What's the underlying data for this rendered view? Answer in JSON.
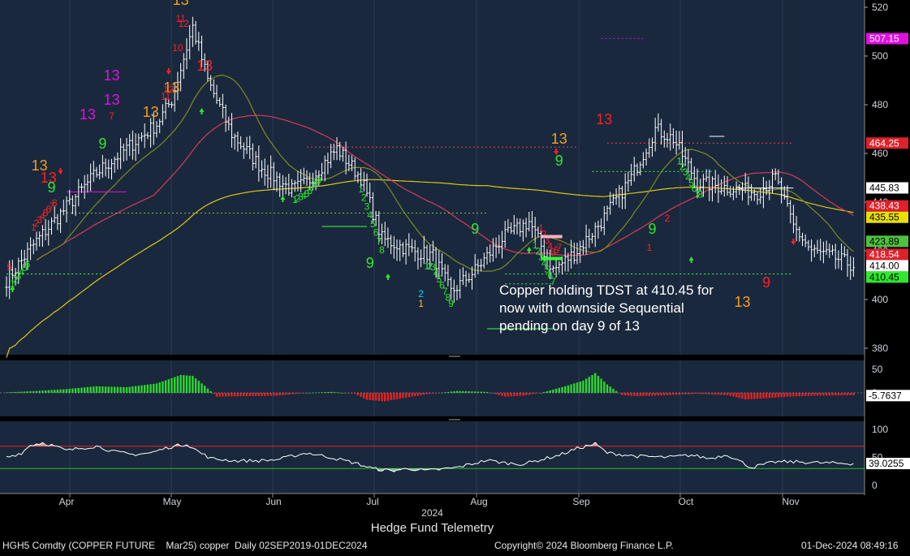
{
  "chart_data": [
    {
      "type": "candlestick",
      "panel": "price",
      "ylim": [
        372,
        522
      ],
      "yticks": [
        "380",
        "400",
        "420",
        "440",
        "460",
        "480",
        "500",
        "520"
      ],
      "x_months": [
        "Apr",
        "May",
        "Jun",
        "Jul",
        "Aug",
        "Sep",
        "Oct",
        "Nov"
      ],
      "x_year": "2024",
      "anchors": [
        [
          0,
          408
        ],
        [
          10,
          424
        ],
        [
          20,
          438
        ],
        [
          30,
          452
        ],
        [
          40,
          462
        ],
        [
          50,
          472
        ],
        [
          55,
          482
        ],
        [
          62,
          512
        ],
        [
          67,
          490
        ],
        [
          75,
          468
        ],
        [
          85,
          454
        ],
        [
          95,
          445
        ],
        [
          100,
          448
        ],
        [
          110,
          462
        ],
        [
          118,
          450
        ],
        [
          125,
          425
        ],
        [
          135,
          420
        ],
        [
          142,
          418
        ],
        [
          148,
          403
        ],
        [
          156,
          412
        ],
        [
          165,
          425
        ],
        [
          174,
          432
        ],
        [
          182,
          412
        ],
        [
          190,
          420
        ],
        [
          198,
          432
        ],
        [
          208,
          450
        ],
        [
          216,
          470
        ],
        [
          222,
          466
        ],
        [
          230,
          448
        ],
        [
          240,
          446
        ],
        [
          250,
          444
        ],
        [
          256,
          450
        ],
        [
          262,
          430
        ],
        [
          268,
          420
        ],
        [
          276,
          417
        ],
        [
          282,
          414
        ]
      ],
      "last_price": "414.00",
      "right_labels": [
        {
          "text": "507.15",
          "value": 507.15,
          "bg": "#e010e0",
          "fg": "#ffffff"
        },
        {
          "text": "464.25",
          "value": 464.25,
          "bg": "#e0202a",
          "fg": "#ffffff"
        },
        {
          "text": "445.83",
          "value": 445.83,
          "bg": "#ffffff",
          "fg": "#000000"
        },
        {
          "text": "438.43",
          "value": 438.43,
          "bg": "#e0202a",
          "fg": "#ffffff"
        },
        {
          "text": "435.55",
          "value": 435.55,
          "bg": "#e8e000",
          "fg": "#000000"
        },
        {
          "text": "423.89",
          "value": 423.89,
          "bg": "#50c040",
          "fg": "#000000"
        },
        {
          "text": "418.54",
          "value": 418.54,
          "bg": "#e0202a",
          "fg": "#ffffff"
        },
        {
          "text": "414.00",
          "value": 414.0,
          "bg": "#ffffff",
          "fg": "#000000"
        },
        {
          "text": "410.45",
          "value": 410.45,
          "bg": "#2ee82e",
          "fg": "#000000"
        }
      ],
      "annotation": [
        "Copper holding TDST at 410.45 for",
        "now with downside Sequential",
        "pending on day 9 of 13"
      ],
      "td_labels": [
        {
          "t": "13",
          "i": 58,
          "v": 521,
          "c": "#f0a020"
        },
        {
          "t": "12",
          "i": 59,
          "v": 512,
          "c": "#ff2020"
        },
        {
          "t": "11",
          "i": 58,
          "v": 514,
          "c": "#ff2020"
        },
        {
          "t": "10",
          "i": 57,
          "v": 502,
          "c": "#ff2020"
        },
        {
          "t": "13",
          "i": 66,
          "v": 494,
          "c": "#ff2020"
        },
        {
          "t": "13",
          "i": 55,
          "v": 485,
          "c": "#f0a020"
        },
        {
          "t": "12",
          "i": 54,
          "v": 485,
          "c": "#ff2020"
        },
        {
          "t": "11",
          "i": 53,
          "v": 482,
          "c": "#ff2020"
        },
        {
          "t": "13",
          "i": 35,
          "v": 490,
          "c": "#e010e0"
        },
        {
          "t": "13",
          "i": 35,
          "v": 480,
          "c": "#e010e0"
        },
        {
          "t": "13",
          "i": 27,
          "v": 474,
          "c": "#e010e0"
        },
        {
          "t": "13",
          "i": 48,
          "v": 475,
          "c": "#f0a020"
        },
        {
          "t": "7",
          "i": 35,
          "v": 474,
          "c": "#ff2020"
        },
        {
          "t": "13",
          "i": 11,
          "v": 453,
          "c": "#f0a020"
        },
        {
          "t": "13",
          "i": 14,
          "v": 448,
          "c": "#ff2020"
        },
        {
          "t": "9",
          "i": 15,
          "v": 444,
          "c": "#2ee82e"
        },
        {
          "t": "9",
          "i": 32,
          "v": 462,
          "c": "#2ee82e"
        },
        {
          "t": "5",
          "i": 1,
          "v": 412,
          "c": "#ff2020"
        },
        {
          "t": "9",
          "i": 121,
          "v": 413,
          "c": "#2ee82e"
        },
        {
          "t": "9",
          "i": 156,
          "v": 427,
          "c": "#2ee82e"
        },
        {
          "t": "13",
          "i": 184,
          "v": 464,
          "c": "#f0a020"
        },
        {
          "t": "9",
          "i": 184,
          "v": 455,
          "c": "#2ee82e"
        },
        {
          "t": "13",
          "i": 199,
          "v": 472,
          "c": "#ff2020"
        },
        {
          "t": "9",
          "i": 215,
          "v": 427,
          "c": "#2ee82e"
        },
        {
          "t": "13",
          "i": 245,
          "v": 397,
          "c": "#f0a020"
        },
        {
          "t": "9",
          "i": 253,
          "v": 405,
          "c": "#ff2020"
        },
        {
          "t": "1",
          "i": 138,
          "v": 397,
          "c": "#f0c030"
        },
        {
          "t": "2",
          "i": 138,
          "v": 401,
          "c": "#00d8ff"
        },
        {
          "t": "1",
          "i": 214,
          "v": 420,
          "c": "#ff2020"
        },
        {
          "t": "2",
          "i": 220,
          "v": 432,
          "c": "#ff2020"
        }
      ],
      "h_lines": [
        {
          "a": 100,
          "b": 190,
          "v": 462.6,
          "c": "#e8404a",
          "dash": "2,3"
        },
        {
          "a": 200,
          "b": 262,
          "v": 464.2,
          "c": "#e8404a",
          "dash": "2,3"
        },
        {
          "a": 20,
          "b": 160,
          "v": 435.5,
          "c": "#7ac050",
          "dash": "2,3"
        },
        {
          "a": 0,
          "b": 32,
          "v": 410.5,
          "c": "#40ff40",
          "dash": "2,3"
        },
        {
          "a": 166,
          "b": 182,
          "v": 406.4,
          "c": "#40ff40",
          "dash": "2,3"
        },
        {
          "a": 166,
          "b": 262,
          "v": 410.5,
          "c": "#40ff40",
          "dash": "2,3"
        },
        {
          "a": 195,
          "b": 235,
          "v": 452.6,
          "c": "#40ff40",
          "dash": "2,3"
        },
        {
          "a": 20,
          "b": 40,
          "v": 444.2,
          "c": "#e010e0",
          "dash": ""
        },
        {
          "a": 198,
          "b": 212,
          "v": 507.2,
          "c": "#e010e0",
          "dash": "2,3"
        },
        {
          "a": 243,
          "b": 262,
          "v": 445.8,
          "c": "#ffffff",
          "dash": ""
        },
        {
          "a": 234,
          "b": 239,
          "v": 467,
          "c": "#ffffff",
          "dash": ""
        },
        {
          "a": 105,
          "b": 120,
          "v": 430,
          "c": "#40ff40",
          "dash": ""
        },
        {
          "a": 160,
          "b": 182,
          "v": 388,
          "c": "#40ff40",
          "dash": ""
        }
      ]
    },
    {
      "type": "histogram",
      "panel": "macd",
      "ylim": [
        -16,
        58
      ],
      "yticks": [
        "50",
        "0"
      ],
      "last_value": "-5.7637",
      "anchors": [
        [
          0,
          1
        ],
        [
          10,
          4
        ],
        [
          20,
          8
        ],
        [
          30,
          14
        ],
        [
          40,
          12
        ],
        [
          50,
          20
        ],
        [
          58,
          38
        ],
        [
          62,
          36
        ],
        [
          66,
          15
        ],
        [
          70,
          -8
        ],
        [
          80,
          -7
        ],
        [
          90,
          -6
        ],
        [
          100,
          0
        ],
        [
          108,
          2
        ],
        [
          116,
          -2
        ],
        [
          120,
          -15
        ],
        [
          126,
          -18
        ],
        [
          133,
          -10
        ],
        [
          140,
          -3
        ],
        [
          150,
          4
        ],
        [
          160,
          2
        ],
        [
          166,
          -8
        ],
        [
          172,
          -6
        ],
        [
          178,
          0
        ],
        [
          186,
          14
        ],
        [
          192,
          26
        ],
        [
          196,
          42
        ],
        [
          200,
          18
        ],
        [
          205,
          -5
        ],
        [
          210,
          -7
        ],
        [
          220,
          -5
        ],
        [
          230,
          -2
        ],
        [
          240,
          -5
        ],
        [
          246,
          -14
        ],
        [
          252,
          -12
        ],
        [
          260,
          -8
        ],
        [
          268,
          -6
        ],
        [
          282,
          -5
        ]
      ]
    },
    {
      "type": "line",
      "panel": "rsi",
      "ylim": [
        -8,
        112
      ],
      "yticks": [
        "100",
        "50",
        "0"
      ],
      "last_value": "39.0255",
      "overbought": 70,
      "oversold": 30,
      "anchors": [
        [
          0,
          50
        ],
        [
          5,
          58
        ],
        [
          8,
          72
        ],
        [
          12,
          76
        ],
        [
          16,
          70
        ],
        [
          20,
          62
        ],
        [
          24,
          66
        ],
        [
          30,
          70
        ],
        [
          36,
          60
        ],
        [
          42,
          55
        ],
        [
          48,
          58
        ],
        [
          54,
          68
        ],
        [
          60,
          74
        ],
        [
          64,
          60
        ],
        [
          68,
          48
        ],
        [
          76,
          44
        ],
        [
          84,
          44
        ],
        [
          90,
          46
        ],
        [
          100,
          58
        ],
        [
          108,
          50
        ],
        [
          116,
          40
        ],
        [
          122,
          30
        ],
        [
          128,
          26
        ],
        [
          134,
          30
        ],
        [
          140,
          26
        ],
        [
          150,
          32
        ],
        [
          160,
          45
        ],
        [
          166,
          40
        ],
        [
          172,
          38
        ],
        [
          178,
          46
        ],
        [
          184,
          54
        ],
        [
          190,
          66
        ],
        [
          196,
          74
        ],
        [
          200,
          58
        ],
        [
          210,
          52
        ],
        [
          220,
          50
        ],
        [
          228,
          54
        ],
        [
          234,
          48
        ],
        [
          240,
          55
        ],
        [
          248,
          32
        ],
        [
          256,
          42
        ],
        [
          264,
          42
        ],
        [
          272,
          40
        ],
        [
          282,
          39
        ]
      ]
    }
  ],
  "footer": {
    "ticker": "HGH5 Comdty (COPPER FUTURE    Mar25) copper  Daily 02SEP2019-01DEC2024",
    "copyright": "Copyright© 2024 Bloomberg Finance L.P.",
    "timestamp": "01-Dec-2024 08:49:16",
    "watermark": "Hedge Fund Telemetry"
  },
  "colors": {
    "panel_bg": "#1a283d",
    "outer_bg": "#0b121c",
    "candle": "#ffffff",
    "ma_red": "#d83a58",
    "ma_yellow": "#dcc814",
    "ma_olive": "#7c8c20",
    "hist_pos": "#2ed82e",
    "hist_neg": "#e82020",
    "rsi_line": "#ffffff",
    "rsi_upper": "#e82020",
    "rsi_lower": "#20c020",
    "axis_text": "#cfd4da"
  }
}
